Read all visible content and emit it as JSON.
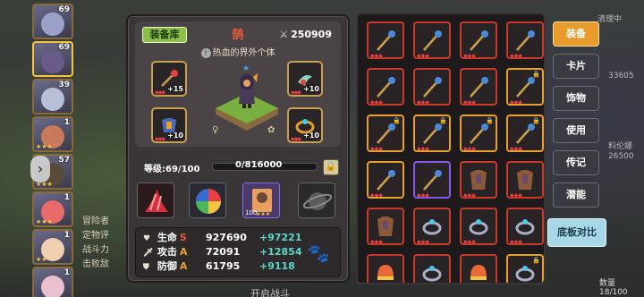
{
  "roster": [
    {
      "level": "69",
      "stars": "",
      "color": "#9aa0c8"
    },
    {
      "level": "69",
      "stars": "",
      "color": "#6a5a8a"
    },
    {
      "level": "39",
      "stars": "",
      "color": "#b8c0d8"
    },
    {
      "level": "1",
      "stars": "★★★",
      "color": "#c87a5a"
    },
    {
      "level": "57",
      "stars": "★★★",
      "color": "#5a4a3a"
    },
    {
      "level": "1",
      "stars": "★★★",
      "color": "#e86a6a"
    },
    {
      "level": "1",
      "stars": "★★",
      "color": "#f0d0b0"
    },
    {
      "level": "1",
      "stars": "",
      "color": "#e8c0d0"
    }
  ],
  "panel": {
    "library_label": "装备库",
    "hero_name": "鹄",
    "title": "热血的界外个体",
    "power": "250909",
    "level_label": "等级:69/100",
    "exp_text": "0/816000"
  },
  "slots": [
    {
      "plus": "+15"
    },
    {
      "plus": "+10"
    },
    {
      "plus": "+10"
    },
    {
      "plus": "+10"
    }
  ],
  "abilities": [
    {
      "label": ""
    },
    {
      "label": ""
    },
    {
      "label": "100"
    },
    {
      "label": ""
    }
  ],
  "stats": [
    {
      "icon": "heart-icon",
      "name": "生命",
      "grade": "S",
      "grade_color": "#e85a3a",
      "value": "927690",
      "bonus": "+97221"
    },
    {
      "icon": "sword-icon",
      "name": "攻击",
      "grade": "A",
      "grade_color": "#e8a030",
      "value": "72091",
      "bonus": "+12854"
    },
    {
      "icon": "shield-icon",
      "name": "防御",
      "grade": "A",
      "grade_color": "#e8a030",
      "value": "61795",
      "bonus": "+9118"
    }
  ],
  "tabs": [
    {
      "label": "装备",
      "active": true
    },
    {
      "label": "卡片",
      "active": false
    },
    {
      "label": "饰物",
      "active": false
    },
    {
      "label": "使用",
      "active": false
    },
    {
      "label": "传记",
      "active": false
    },
    {
      "label": "潜能",
      "active": false
    }
  ],
  "compare_label": "底板对比",
  "count_label": "数量 18/100",
  "inventory": [
    {
      "type": "staff",
      "tier": "red",
      "lock": false
    },
    {
      "type": "staff",
      "tier": "red",
      "lock": false
    },
    {
      "type": "staff",
      "tier": "red",
      "lock": false
    },
    {
      "type": "staff",
      "tier": "red",
      "lock": false
    },
    {
      "type": "staff",
      "tier": "red",
      "lock": false
    },
    {
      "type": "staff",
      "tier": "red",
      "lock": false
    },
    {
      "type": "staff",
      "tier": "red",
      "lock": false
    },
    {
      "type": "staff",
      "tier": "gold",
      "lock": true
    },
    {
      "type": "staff",
      "tier": "gold",
      "lock": true
    },
    {
      "type": "staff",
      "tier": "gold",
      "lock": true
    },
    {
      "type": "staff",
      "tier": "gold",
      "lock": true
    },
    {
      "type": "staff",
      "tier": "gold",
      "lock": true
    },
    {
      "type": "staff",
      "tier": "gold",
      "lock": false
    },
    {
      "type": "staff",
      "tier": "purple",
      "lock": false
    },
    {
      "type": "armor",
      "tier": "red",
      "lock": false
    },
    {
      "type": "armor",
      "tier": "red",
      "lock": false
    },
    {
      "type": "armor",
      "tier": "red",
      "lock": false
    },
    {
      "type": "ring",
      "tier": "red",
      "lock": false
    },
    {
      "type": "ring",
      "tier": "red",
      "lock": false
    },
    {
      "type": "ring",
      "tier": "red",
      "lock": false
    },
    {
      "type": "helmet",
      "tier": "red",
      "lock": false
    },
    {
      "type": "ring",
      "tier": "red",
      "lock": false
    },
    {
      "type": "helmet",
      "tier": "red",
      "lock": false
    },
    {
      "type": "ring",
      "tier": "gold",
      "lock": true
    }
  ],
  "scene": {
    "left_text": [
      "冒险者",
      "定物评",
      "战斗力",
      "击败敌"
    ],
    "right_labels": [
      "清理中",
      "33605",
      "料伦娜",
      "26500"
    ],
    "bottom_text": "开启战斗"
  }
}
